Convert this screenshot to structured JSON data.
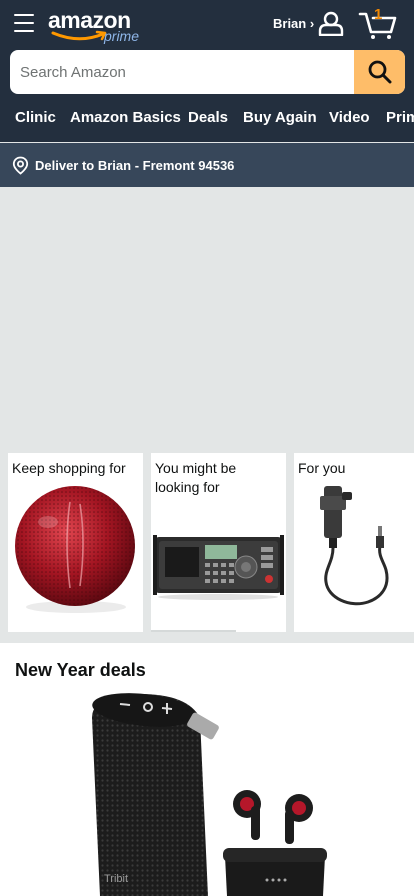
{
  "header": {
    "logo_text": "amazon",
    "logo_sub": "prime",
    "user_label": "Brian ›",
    "cart_count": "1"
  },
  "search": {
    "placeholder": "Search Amazon"
  },
  "nav": {
    "items": [
      "Clinic",
      "Amazon Basics",
      "Deals",
      "Buy Again",
      "Video",
      "Prime"
    ]
  },
  "delivery": {
    "text": "Deliver to Brian - Fremont 94536"
  },
  "cards": [
    {
      "title": "Keep shopping for"
    },
    {
      "title": "You might be looking for"
    },
    {
      "title": "For you"
    }
  ],
  "deals": {
    "title": "New Year deals",
    "speaker_brand": "Tribit"
  },
  "colors": {
    "header_bg": "#232f3e",
    "delivery_bg": "#37475a",
    "search_button": "#febd69",
    "cart_count": "#f08804",
    "page_bg": "#e3e6e6"
  }
}
